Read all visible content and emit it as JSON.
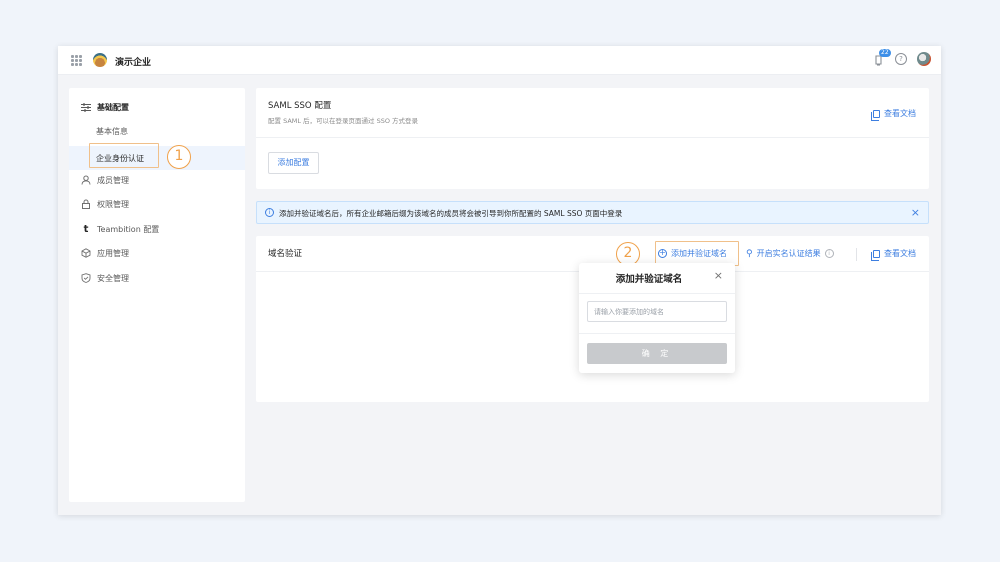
{
  "topbar": {
    "org_name": "演示企业",
    "notification_count": "22",
    "help_glyph": "?"
  },
  "sidebar": {
    "items": [
      {
        "label": "基础配置",
        "icon": "sliders-icon"
      },
      {
        "label": "基本信息"
      },
      {
        "label": "企业身份认证"
      },
      {
        "label": "成员管理",
        "icon": "user-icon"
      },
      {
        "label": "权限管理",
        "icon": "lock-icon"
      },
      {
        "label": "Teambition 配置",
        "icon": "teambition-icon"
      },
      {
        "label": "应用管理",
        "icon": "cube-icon"
      },
      {
        "label": "安全管理",
        "icon": "shield-icon"
      }
    ]
  },
  "steps": {
    "one": "1",
    "two": "2"
  },
  "saml": {
    "title": "SAML SSO 配置",
    "description": "配置 SAML 后，可以在登录页面通过 SSO 方式登录",
    "doc_link": "查看文档",
    "add_button": "添加配置"
  },
  "notice": {
    "text": "添加并验证域名后，所有企业邮箱后缀为该域名的成员将会被引导到你所配置的 SAML SSO 页面中登录",
    "close": "×"
  },
  "domain": {
    "title": "域名验证",
    "add_link": "添加并验证域名",
    "realname_link": "开启实名认证结果",
    "doc_link": "查看文档"
  },
  "popover": {
    "title": "添加并验证域名",
    "close": "×",
    "input_placeholder": "请输入你要添加的域名",
    "confirm_button": "确 定"
  },
  "colors": {
    "accent": "#3d7ee0",
    "highlight": "#f0a14a"
  }
}
